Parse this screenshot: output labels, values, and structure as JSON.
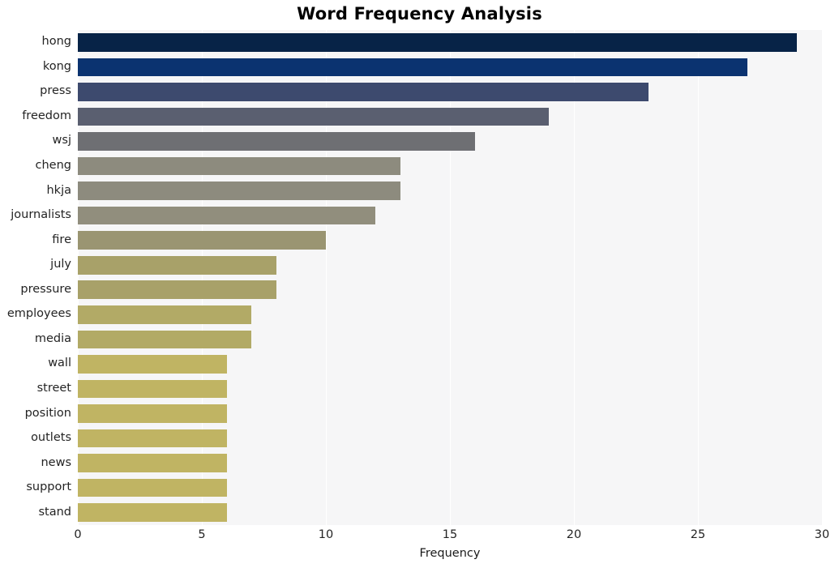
{
  "chart_data": {
    "type": "bar",
    "orientation": "horizontal",
    "title": "Word Frequency Analysis",
    "xlabel": "Frequency",
    "ylabel": "",
    "xlim": [
      0,
      30
    ],
    "xticks": [
      0,
      5,
      10,
      15,
      20,
      25,
      30
    ],
    "xtick_labels": [
      "0",
      "5",
      "10",
      "15",
      "20",
      "25",
      "30"
    ],
    "grid": true,
    "grid_axis": "x",
    "grid_color": "#ffffff",
    "plot_background": "#f6f6f7",
    "figure_background": "#ffffff",
    "legend": false,
    "categories": [
      "hong",
      "kong",
      "press",
      "freedom",
      "wsj",
      "cheng",
      "hkja",
      "journalists",
      "fire",
      "july",
      "pressure",
      "employees",
      "media",
      "wall",
      "street",
      "position",
      "outlets",
      "news",
      "support",
      "stand"
    ],
    "values": [
      29,
      27,
      23,
      19,
      16,
      13,
      13,
      12,
      10,
      8,
      8,
      7,
      7,
      6,
      6,
      6,
      6,
      6,
      6,
      6
    ],
    "bar_colors": [
      "#072347",
      "#0b3370",
      "#3d4a६e",
      "#5a5f70",
      "#6e6f73",
      "#8d8b7e",
      "#8d8b7e",
      "#918e7d",
      "#9a9572",
      "#a8a169",
      "#a8a169",
      "#b2aa66",
      "#b2aa66",
      "#c0b463",
      "#c0b463",
      "#c0b463",
      "#c0b463",
      "#c0b463",
      "#c0b463",
      "#c0b463"
    ]
  },
  "bar_palette": [
    "#072347",
    "#0b3370",
    "#3d4a6e",
    "#5a5f70",
    "#6e6f73",
    "#8d8b7e",
    "#8d8b7e",
    "#918e7d",
    "#9a9572",
    "#a8a169",
    "#a8a169",
    "#b2aa66",
    "#b2aa66",
    "#c0b463",
    "#c0b463",
    "#c0b463",
    "#c0b463",
    "#c0b463",
    "#c0b463",
    "#c0b463"
  ]
}
